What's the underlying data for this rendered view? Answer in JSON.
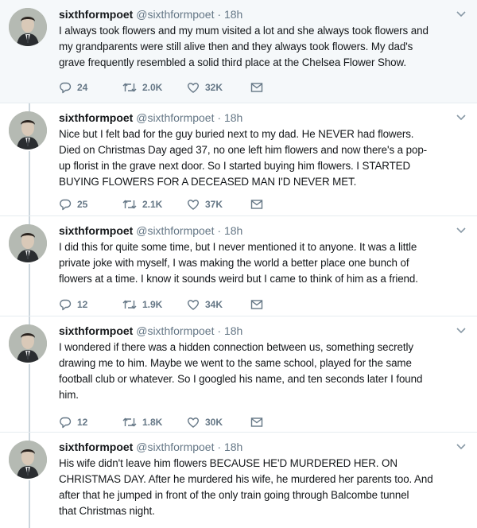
{
  "tweets": [
    {
      "name": "sixthformpoet",
      "handle": "@sixthformpoet",
      "separator": "·",
      "time": "18h",
      "lines": [
        "I always took flowers and my mum visited a lot and she always took flowers and",
        "my grandparents were still alive then and they always took flowers. My dad's",
        "grave frequently resembled a solid third place at the Chelsea Flower Show."
      ],
      "replies": "24",
      "retweets": "2.0K",
      "likes": "32K"
    },
    {
      "name": "sixthformpoet",
      "handle": "@sixthformpoet",
      "separator": "·",
      "time": "18h",
      "lines": [
        "Nice but I felt bad for the guy buried next to my dad. He NEVER had flowers.",
        "Died on Christmas Day aged 37, no one left him flowers and now there's a pop-",
        "up florist in the grave next door. So I started buying him flowers. I STARTED",
        "BUYING FLOWERS FOR A DECEASED MAN I'D NEVER MET."
      ],
      "replies": "25",
      "retweets": "2.1K",
      "likes": "37K"
    },
    {
      "name": "sixthformpoet",
      "handle": "@sixthformpoet",
      "separator": "·",
      "time": "18h",
      "lines": [
        "I did this for quite some time, but I never mentioned it to anyone. It was a little",
        "private joke with myself, I was making the world a better place one bunch of",
        "flowers at a time. I know it sounds weird but I came to think of him as a friend."
      ],
      "replies": "12",
      "retweets": "1.9K",
      "likes": "34K"
    },
    {
      "name": "sixthformpoet",
      "handle": "@sixthformpoet",
      "separator": "·",
      "time": "18h",
      "lines": [
        "I wondered if there was a hidden connection between us, something secretly",
        "drawing me to him. Maybe we went to the same school, played for the same",
        "football club or whatever. So I googled his name, and ten seconds later I found",
        "him."
      ],
      "replies": "12",
      "retweets": "1.8K",
      "likes": "30K"
    },
    {
      "name": "sixthformpoet",
      "handle": "@sixthformpoet",
      "separator": "·",
      "time": "18h",
      "lines": [
        "His wife didn't leave him flowers BECAUSE HE'D MURDERED HER. ON",
        "CHRISTMAS DAY. After he murdered his wife, he murdered her parents too. And",
        "after that he jumped in front of the only train going through Balcombe tunnel",
        "that Christmas night."
      ],
      "replies": "",
      "retweets": "",
      "likes": ""
    }
  ],
  "icons": {
    "reply": "reply-icon",
    "retweet": "retweet-icon",
    "like": "like-icon",
    "message": "direct-message-icon",
    "caret": "chevron-down-icon"
  },
  "colors": {
    "thread_line": "#ccd6dd",
    "muted_text": "#657786",
    "highlight_bg": "#f5f8fa"
  }
}
